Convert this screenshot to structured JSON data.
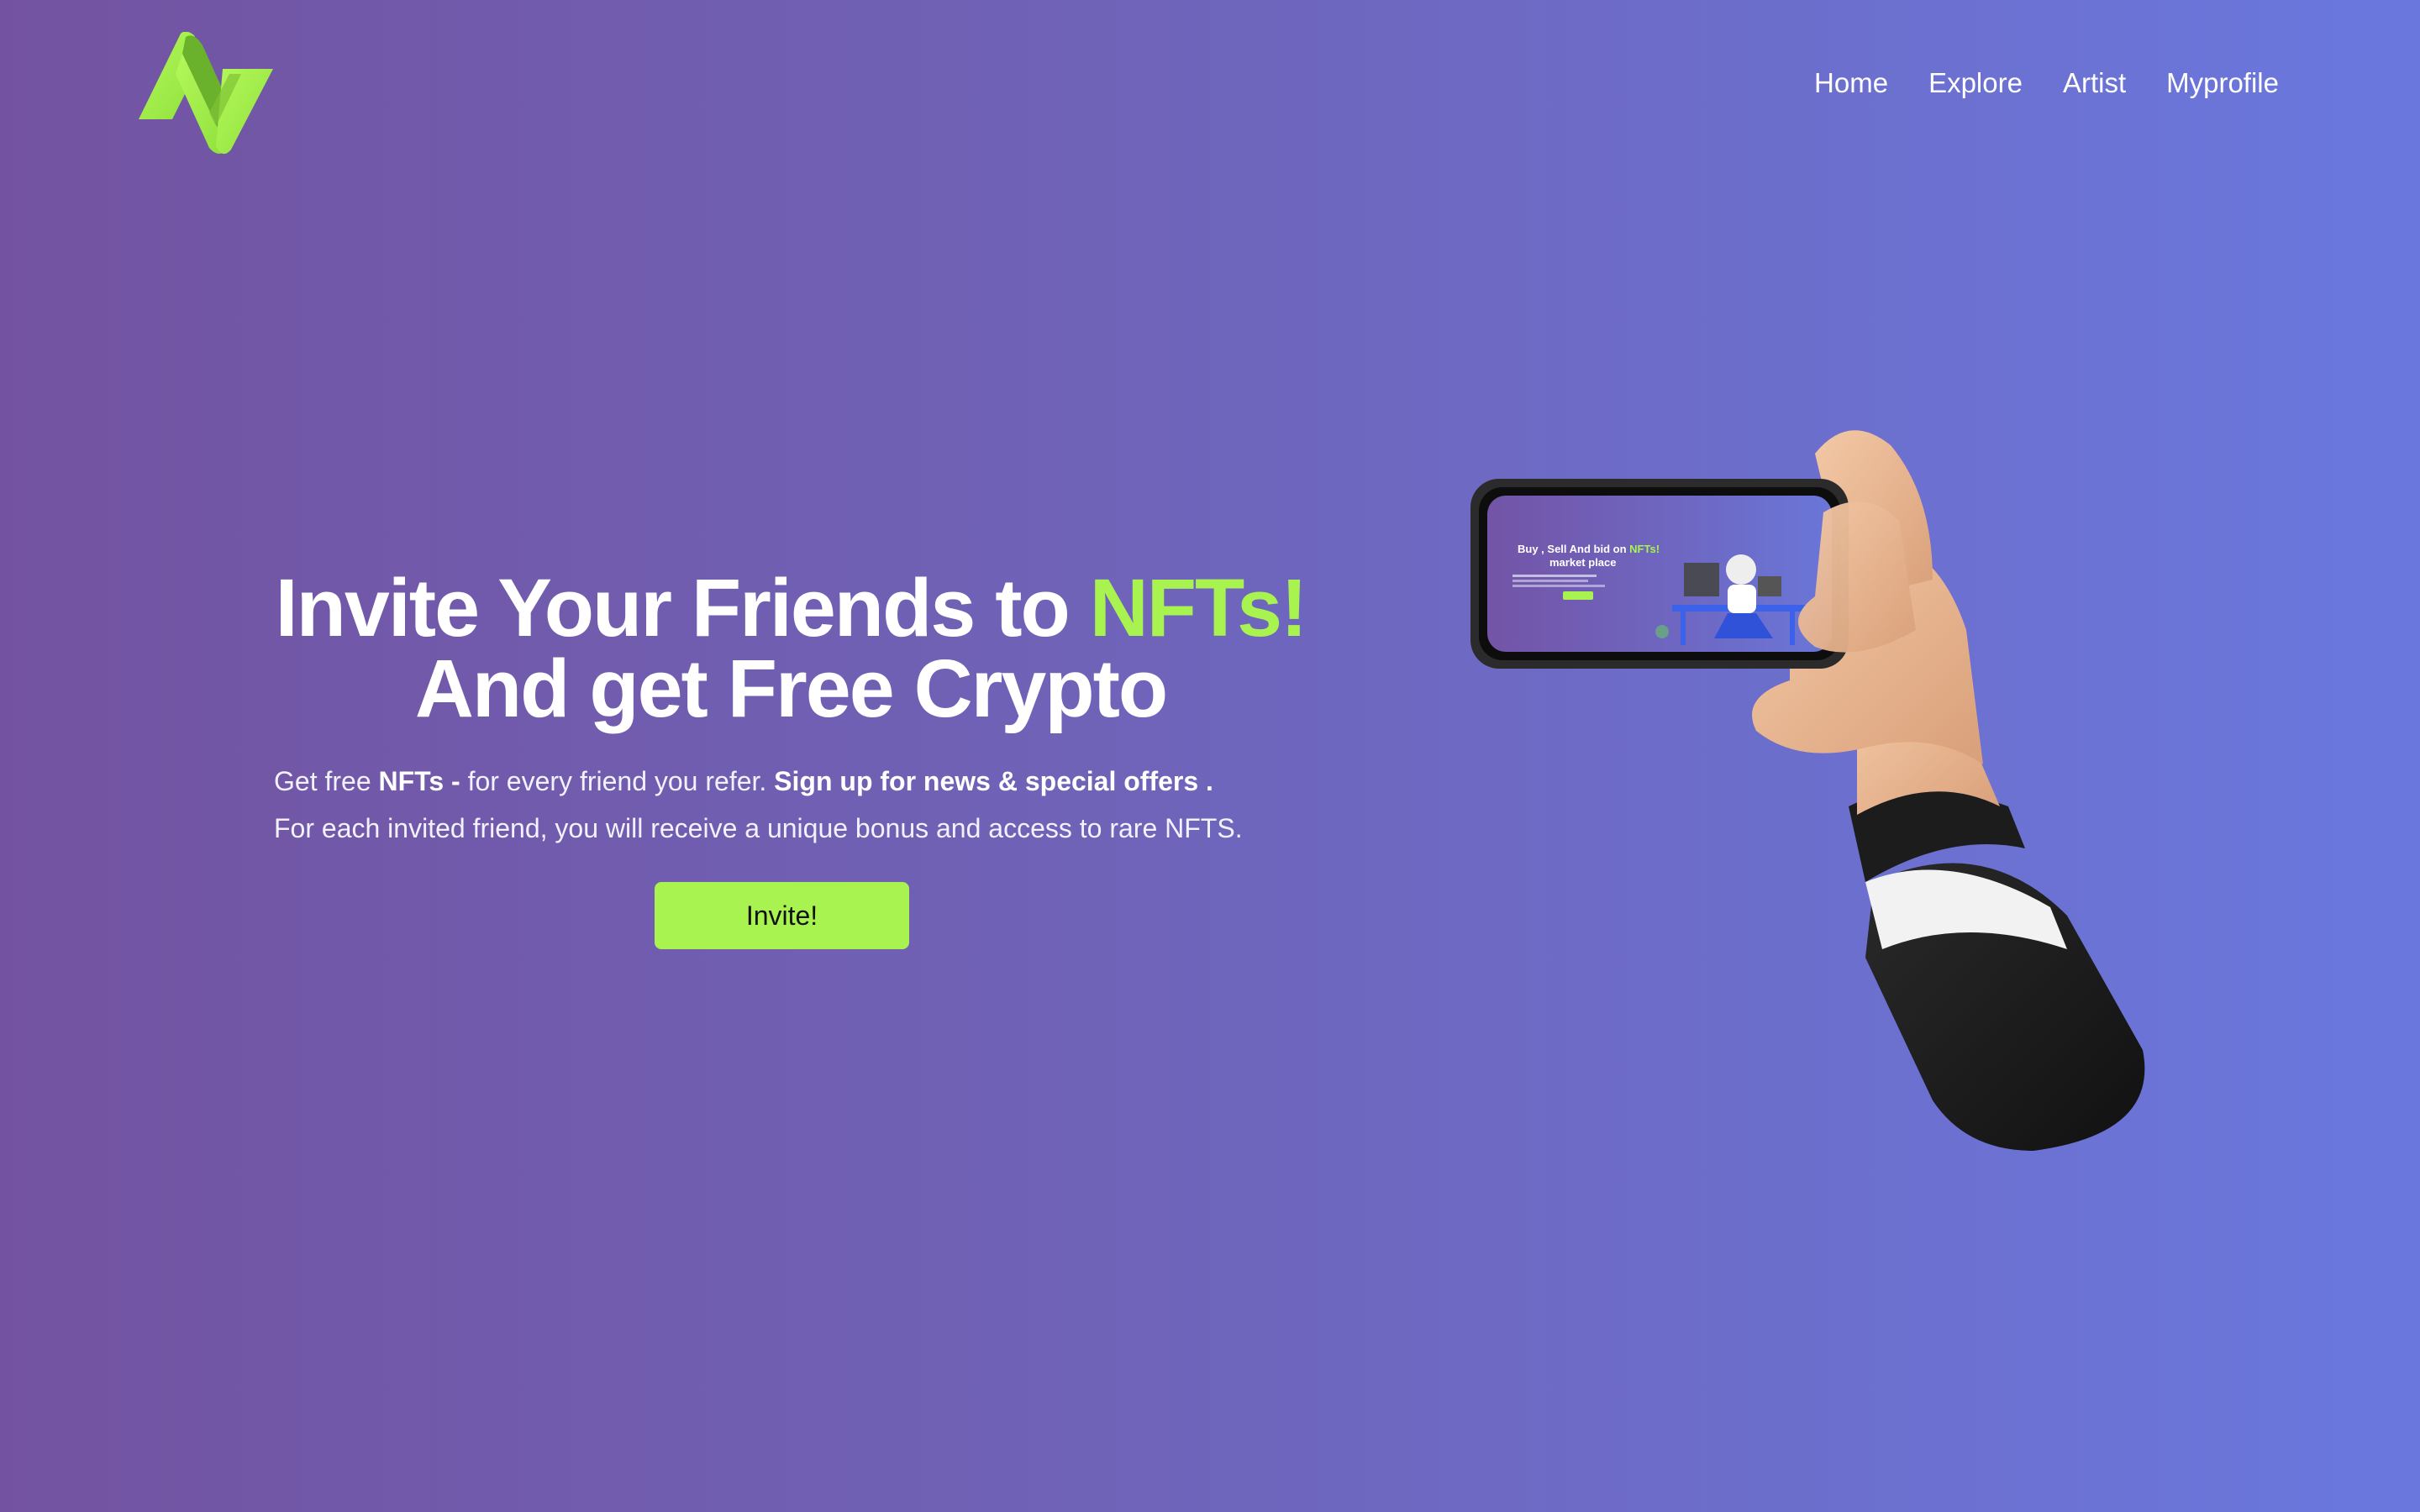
{
  "nav": {
    "items": [
      {
        "label": "Home"
      },
      {
        "label": "Explore"
      },
      {
        "label": "Artist"
      },
      {
        "label": "Myprofile"
      }
    ]
  },
  "hero": {
    "headline_part1": "Invite Your Friends to",
    "headline_accent": "NFTs!",
    "headline_line2": "And get Free Crypto",
    "sub1_pre": "Get free",
    "sub1_bold1": "NFTs -",
    "sub1_mid": "for every friend you refer.",
    "sub1_bold2": "Sign up for news & special offers .",
    "sub2": "For each invited friend, you will receive a unique bonus and access to rare NFTS.",
    "button_label": "Invite!"
  },
  "phone_screen": {
    "title_pre": "Buy , Sell And bid on",
    "title_accent": "NFTs!",
    "title_line2": "market place"
  },
  "colors": {
    "accent": "#a8f34f",
    "bg_left": "#7353a1",
    "bg_right": "#6a78de"
  }
}
